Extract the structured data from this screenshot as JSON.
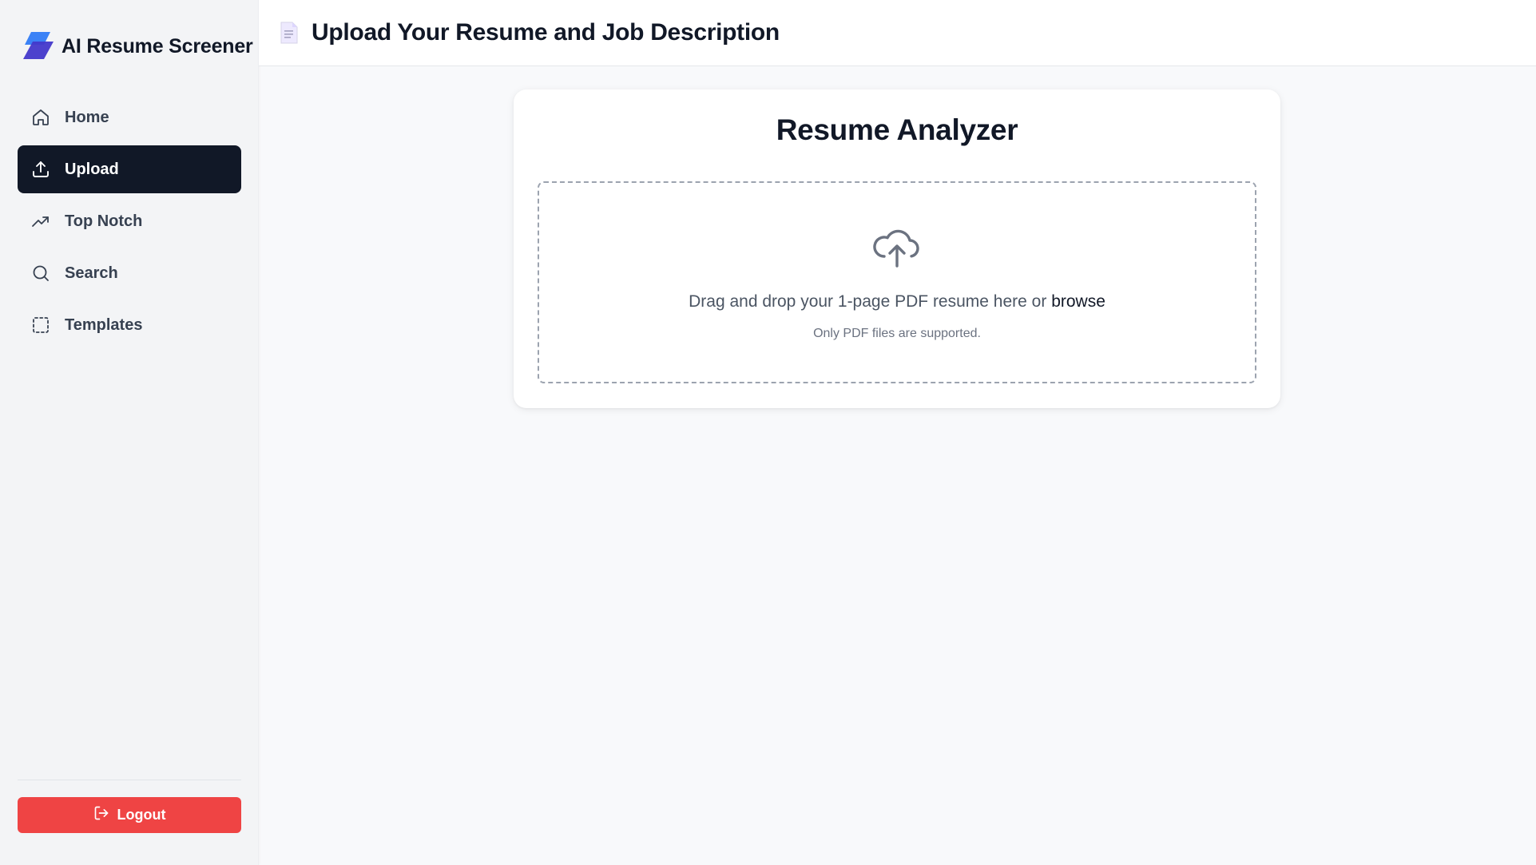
{
  "brand": {
    "name": "AI Resume Screener",
    "accent": "#4f46e5",
    "logo_icon": "stacked-parallelogram-logo"
  },
  "sidebar": {
    "items": [
      {
        "label": "Home",
        "icon": "home-icon",
        "active": false
      },
      {
        "label": "Upload",
        "icon": "upload-icon",
        "active": true
      },
      {
        "label": "Top Notch",
        "icon": "trending-up-icon",
        "active": false
      },
      {
        "label": "Search",
        "icon": "search-icon",
        "active": false
      },
      {
        "label": "Templates",
        "icon": "dashed-square-icon",
        "active": false
      }
    ],
    "logout_label": "Logout",
    "logout_color": "#ef4444"
  },
  "header": {
    "title": "Upload Your Resume and Job Description",
    "icon": "document-icon"
  },
  "card": {
    "title": "Resume Analyzer",
    "dropzone": {
      "icon": "cloud-upload-icon",
      "text": "Drag and drop your 1-page PDF resume here or ",
      "browse_label": "browse",
      "hint": "Only PDF files are supported."
    }
  },
  "colors": {
    "active_nav_bg": "#111827",
    "page_bg": "#f8f9fb",
    "sidebar_bg": "#f3f4f6"
  }
}
